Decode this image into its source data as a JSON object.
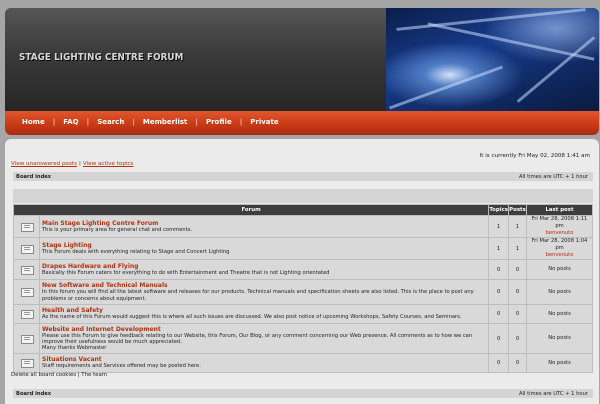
{
  "header": {
    "title": "STAGE LIGHTING CENTRE FORUM"
  },
  "nav": {
    "items": [
      "Home",
      "FAQ",
      "Search",
      "Memberlist",
      "Profile",
      "Private"
    ],
    "separator": "|"
  },
  "top": {
    "unanswered": "View unanswered posts",
    "separator": "|",
    "active": "View active topics",
    "current_time": "It is currently Fri May 02, 2008 1:41 am"
  },
  "board_bar": {
    "index_label": "Board index",
    "timezone": "All times are UTC + 1 hour"
  },
  "table": {
    "headers": [
      "Forum",
      "Topics",
      "Posts",
      "Last post"
    ],
    "rows": [
      {
        "name": "Main Stage Lighting Centre Forum",
        "desc": "This is your primary area for general chat and comments.",
        "topics": "1",
        "posts": "1",
        "last_date": "Fri Mar 28, 2008 1:11 pm",
        "last_user": "benvenuto"
      },
      {
        "name": "Stage Lighting",
        "desc": "This Forum deals with everything relating to Stage and Concert Lighting",
        "topics": "1",
        "posts": "1",
        "last_date": "Fri Mar 28, 2008 1:04 pm",
        "last_user": "benvenuto"
      },
      {
        "name": "Drapes Hardware and Flying",
        "desc": "Basically this Forum caters for everything to do with Entertainment and Theatre that is not Lighting orientated",
        "topics": "0",
        "posts": "0",
        "last_date": "No posts",
        "last_user": ""
      },
      {
        "name": "New Software and Technical Manuals",
        "desc": "In this forum you will find all the latest software and releases for our products. Technical manuals and specification sheets are also listed. This is the place to post any problems or concerns about equipment.",
        "topics": "0",
        "posts": "0",
        "last_date": "No posts",
        "last_user": ""
      },
      {
        "name": "Health and Safety",
        "desc": "As the name of this Forum would suggest this is where all such issues are discussed. We also post notice of upcoming Workshops, Safety Courses, and Seminars.",
        "topics": "0",
        "posts": "0",
        "last_date": "No posts",
        "last_user": ""
      },
      {
        "name": "Website and Internet Development",
        "desc": "Please use this Forum to give feedback relating to our Website, this Forum, Our Blog, or any comment concerning our Web presence. All comments as to how we can improve their usefulness would be much appreciated.",
        "desc2": "Many thanks Webmaster",
        "topics": "0",
        "posts": "0",
        "last_date": "No posts",
        "last_user": ""
      },
      {
        "name": "Situations Vacant",
        "desc": "Staff requirements and Services offered may be posted here.",
        "topics": "0",
        "posts": "0",
        "last_date": "No posts",
        "last_user": ""
      }
    ]
  },
  "bottom": {
    "delete_cookies": "Delete all board cookies",
    "separator": "|",
    "team": "The team"
  },
  "icons": {
    "forum": "forum-folder-icon",
    "last_post": "view-latest-post-icon"
  }
}
